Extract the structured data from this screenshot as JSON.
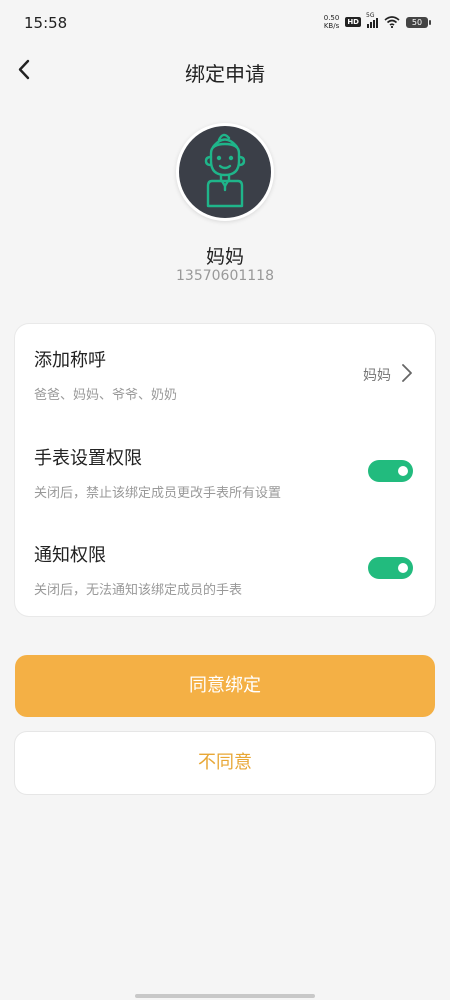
{
  "status_bar": {
    "time": "15:58",
    "net_speed_value": "0.50",
    "net_speed_unit": "KB/s",
    "hd": "HD",
    "signal": "5G",
    "battery": "50"
  },
  "header": {
    "title": "绑定申请",
    "back_icon": "chevron-left-icon"
  },
  "profile": {
    "avatar_icon": "child-avatar-icon",
    "name": "妈妈",
    "phone": "13570601118"
  },
  "settings": {
    "nickname": {
      "title": "添加称呼",
      "description": "爸爸、妈妈、爷爷、奶奶",
      "value": "妈妈"
    },
    "watch_permission": {
      "title": "手表设置权限",
      "description": "关闭后，禁止该绑定成员更改手表所有设置",
      "enabled": true
    },
    "notify_permission": {
      "title": "通知权限",
      "description": "关闭后，无法通知该绑定成员的手表",
      "enabled": true
    }
  },
  "actions": {
    "agree_label": "同意绑定",
    "disagree_label": "不同意"
  },
  "colors": {
    "accent": "#f4b045",
    "toggle_on": "#22bb7e",
    "avatar_bg": "#3b3f48",
    "avatar_line": "#1fb58a"
  }
}
